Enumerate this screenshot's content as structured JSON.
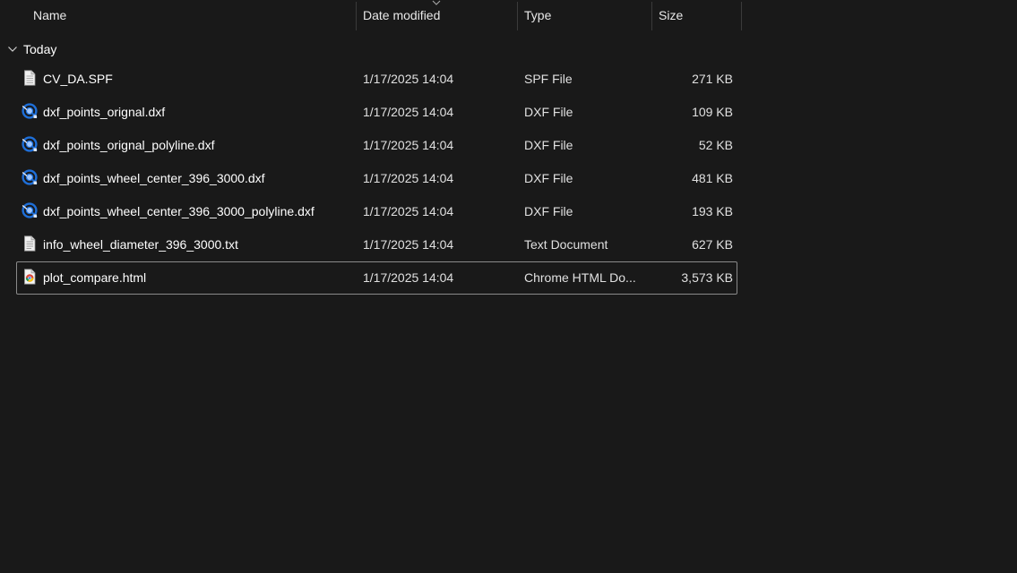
{
  "columns": {
    "name": "Name",
    "date": "Date modified",
    "type": "Type",
    "size": "Size"
  },
  "sort": {
    "column": "date",
    "direction": "descending"
  },
  "group": {
    "label": "Today",
    "expanded": true
  },
  "files": [
    {
      "name": "CV_DA.SPF",
      "date": "1/17/2025 14:04",
      "type": "SPF File",
      "size": "271 KB",
      "icon": "generic-file-icon"
    },
    {
      "name": "dxf_points_orignal.dxf",
      "date": "1/17/2025 14:04",
      "type": "DXF File",
      "size": "109 KB",
      "icon": "dxf-file-icon"
    },
    {
      "name": "dxf_points_orignal_polyline.dxf",
      "date": "1/17/2025 14:04",
      "type": "DXF File",
      "size": "52 KB",
      "icon": "dxf-file-icon"
    },
    {
      "name": "dxf_points_wheel_center_396_3000.dxf",
      "date": "1/17/2025 14:04",
      "type": "DXF File",
      "size": "481 KB",
      "icon": "dxf-file-icon"
    },
    {
      "name": "dxf_points_wheel_center_396_3000_polyline.dxf",
      "date": "1/17/2025 14:04",
      "type": "DXF File",
      "size": "193 KB",
      "icon": "dxf-file-icon"
    },
    {
      "name": "info_wheel_diameter_396_3000.txt",
      "date": "1/17/2025 14:04",
      "type": "Text Document",
      "size": "627 KB",
      "icon": "text-file-icon"
    },
    {
      "name": "plot_compare.html",
      "date": "1/17/2025 14:04",
      "type": "Chrome HTML Do...",
      "size": "3,573 KB",
      "icon": "chrome-html-icon",
      "selected": true
    }
  ],
  "colors": {
    "background": "#191919",
    "text": "#ffffff",
    "dxf_icon_blue": "#1e6fd9",
    "selection_border": "#8a8a8a"
  }
}
